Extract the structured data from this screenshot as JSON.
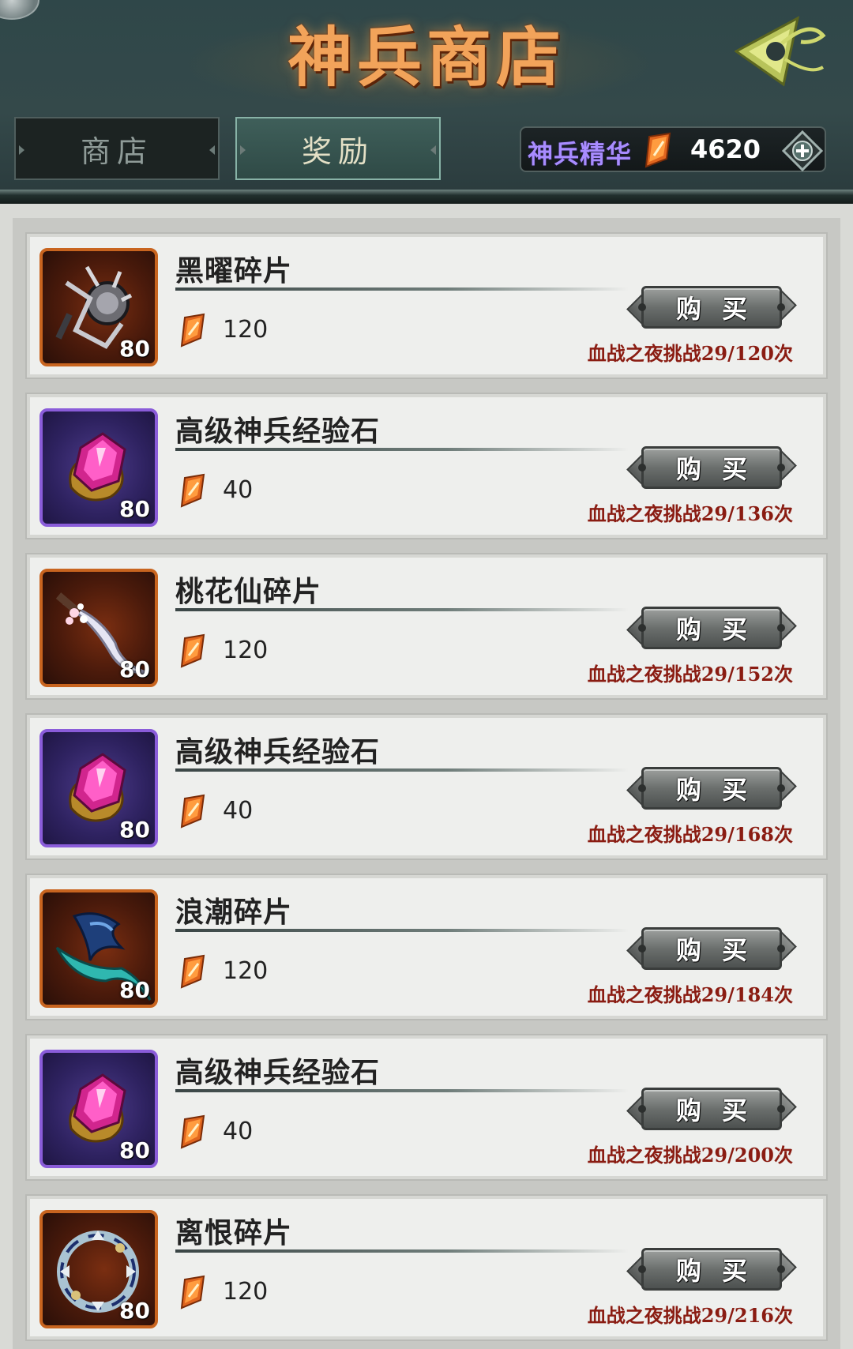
{
  "header": {
    "title": "神兵商店",
    "back_icon": "triangle-emblem-icon",
    "tabs": [
      {
        "label": "商店",
        "active": false
      },
      {
        "label": "奖励",
        "active": true
      }
    ],
    "currency": {
      "label": "神兵精华",
      "value": "4620",
      "icon": "essence-crystal-icon",
      "add_icon": "plus-icon"
    }
  },
  "colors": {
    "header_bg": "#34494a",
    "title": "#f2a35a",
    "currency_label": "#a88cff",
    "limit_text": "#8a1c12",
    "rarity_orange": "#c8641f",
    "rarity_purple": "#8a5cd9"
  },
  "items": [
    {
      "name": "黑曜碎片",
      "price": "120",
      "level": "80",
      "rarity": "orange",
      "icon": "obsidian-gauntlet-icon",
      "buy_label": "购买",
      "limit": "血战之夜挑战29/120次"
    },
    {
      "name": "高级神兵经验石",
      "price": "40",
      "level": "80",
      "rarity": "purple",
      "icon": "purple-gem-icon",
      "buy_label": "购买",
      "limit": "血战之夜挑战29/136次"
    },
    {
      "name": "桃花仙碎片",
      "price": "120",
      "level": "80",
      "rarity": "orange",
      "icon": "blossom-blade-icon",
      "buy_label": "购买",
      "limit": "血战之夜挑战29/152次"
    },
    {
      "name": "高级神兵经验石",
      "price": "40",
      "level": "80",
      "rarity": "purple",
      "icon": "purple-gem-icon",
      "buy_label": "购买",
      "limit": "血战之夜挑战29/168次"
    },
    {
      "name": "浪潮碎片",
      "price": "120",
      "level": "80",
      "rarity": "orange",
      "icon": "wave-blade-icon",
      "buy_label": "购买",
      "limit": "血战之夜挑战29/184次"
    },
    {
      "name": "高级神兵经验石",
      "price": "40",
      "level": "80",
      "rarity": "purple",
      "icon": "purple-gem-icon",
      "buy_label": "购买",
      "limit": "血战之夜挑战29/200次"
    },
    {
      "name": "离恨碎片",
      "price": "120",
      "level": "80",
      "rarity": "orange",
      "icon": "chakram-ring-icon",
      "buy_label": "购买",
      "limit": "血战之夜挑战29/216次"
    }
  ]
}
